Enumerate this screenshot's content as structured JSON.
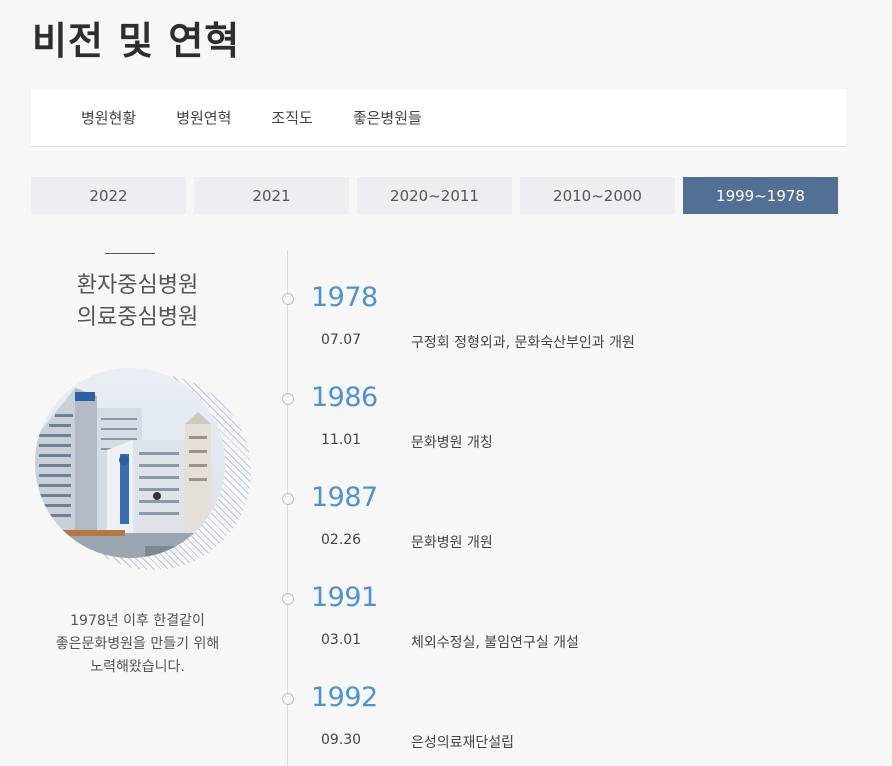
{
  "page": {
    "title": "비전 및 연혁"
  },
  "subnav": {
    "items": [
      {
        "label": "병원현황"
      },
      {
        "label": "병원연혁"
      },
      {
        "label": "조직도"
      },
      {
        "label": "좋은병원들"
      }
    ]
  },
  "year_tabs": {
    "items": [
      {
        "label": "2022"
      },
      {
        "label": "2021"
      },
      {
        "label": "2020~2011"
      },
      {
        "label": "2010~2000"
      },
      {
        "label": "1999~1978"
      }
    ],
    "active": "1999~1978"
  },
  "left": {
    "slogan_line1": "환자중심병원",
    "slogan_line2": "의료중심병원",
    "tagline_line1": "1978년 이후 한결같이",
    "tagline_line2": "좋은문화병원을 만들기 위해",
    "tagline_line3": "노력해왔습니다."
  },
  "timeline": [
    {
      "year": "1978",
      "date": "07.07",
      "text": "구정회 정형외과, 문화숙산부인과 개원"
    },
    {
      "year": "1986",
      "date": "11.01",
      "text": "문화병원 개칭"
    },
    {
      "year": "1987",
      "date": "02.26",
      "text": "문화병원 개원"
    },
    {
      "year": "1991",
      "date": "03.01",
      "text": "체외수정실, 불임연구실 개설"
    },
    {
      "year": "1992",
      "date": "09.30",
      "text": "은성의료재단설립"
    }
  ],
  "colors": {
    "accent": "#546f95",
    "year_text": "#4c93d3",
    "tab_bg": "#eeeef2",
    "page_bg": "#f8f7f8"
  }
}
